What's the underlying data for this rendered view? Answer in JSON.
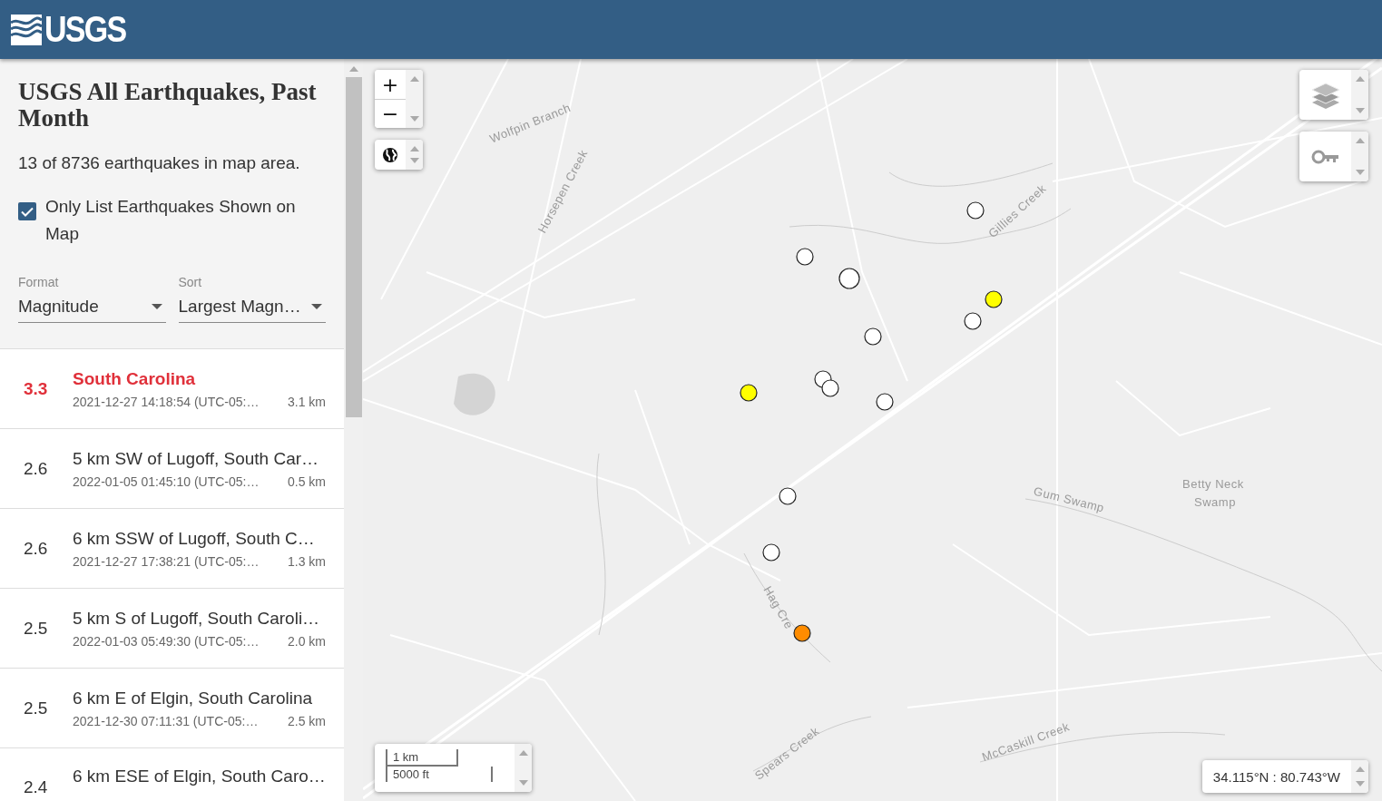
{
  "header": {
    "logo": "USGS"
  },
  "sidebar": {
    "title": "USGS All Earthquakes, Past Month",
    "count": "13 of 8736 earthquakes in map area.",
    "only_list_shown": {
      "label": "Only List Earthquakes Shown on Map",
      "checked": true
    },
    "format": {
      "label": "Format",
      "value": "Magnitude"
    },
    "sort": {
      "label": "Sort",
      "value": "Largest Magn…"
    }
  },
  "earthquakes": [
    {
      "magnitude": "3.3",
      "place": "South Carolina",
      "time": "2021-12-27 14:18:54 (UTC-05:…",
      "depth": "3.1 km",
      "alert": true
    },
    {
      "magnitude": "2.6",
      "place": "5 km SW of Lugoff, South Car…",
      "time": "2022-01-05 01:45:10 (UTC-05:…",
      "depth": "0.5 km",
      "alert": false
    },
    {
      "magnitude": "2.6",
      "place": "6 km SSW of Lugoff, South C…",
      "time": "2021-12-27 17:38:21 (UTC-05:…",
      "depth": "1.3 km",
      "alert": false
    },
    {
      "magnitude": "2.5",
      "place": "5 km S of Lugoff, South Caroli…",
      "time": "2022-01-03 05:49:30 (UTC-05:…",
      "depth": "2.0 km",
      "alert": false
    },
    {
      "magnitude": "2.5",
      "place": "6 km E of Elgin, South Carolina",
      "time": "2021-12-30 07:11:31 (UTC-05:…",
      "depth": "2.5 km",
      "alert": false
    },
    {
      "magnitude": "2.4",
      "place": "6 km ESE of Elgin, South Caro…",
      "alert": false
    }
  ],
  "map": {
    "labels": [
      "Wolfpin Branch",
      "Horsepen Creek",
      "Gillies Creek",
      "Gum Swamp",
      "Betty Neck Swamp",
      "Hag Cre",
      "Spears Creek",
      "McCaskill Creek"
    ],
    "markers": [
      {
        "color": "#ffffff"
      },
      {
        "color": "#ffffff"
      },
      {
        "color": "#ffffff"
      },
      {
        "color": "#ffff00"
      },
      {
        "color": "#ffffff"
      },
      {
        "color": "#ffffff"
      },
      {
        "color": "#ffff00"
      },
      {
        "color": "#ffffff"
      },
      {
        "color": "#ffffff"
      },
      {
        "color": "#ffffff"
      },
      {
        "color": "#ffffff"
      },
      {
        "color": "#ffffff"
      },
      {
        "color": "#ff8c00"
      }
    ],
    "zoom_in": "+",
    "zoom_out": "−",
    "scale": {
      "metric": "1 km",
      "imperial": "5000 ft"
    },
    "coordinates": "34.115°N : 80.743°W"
  }
}
